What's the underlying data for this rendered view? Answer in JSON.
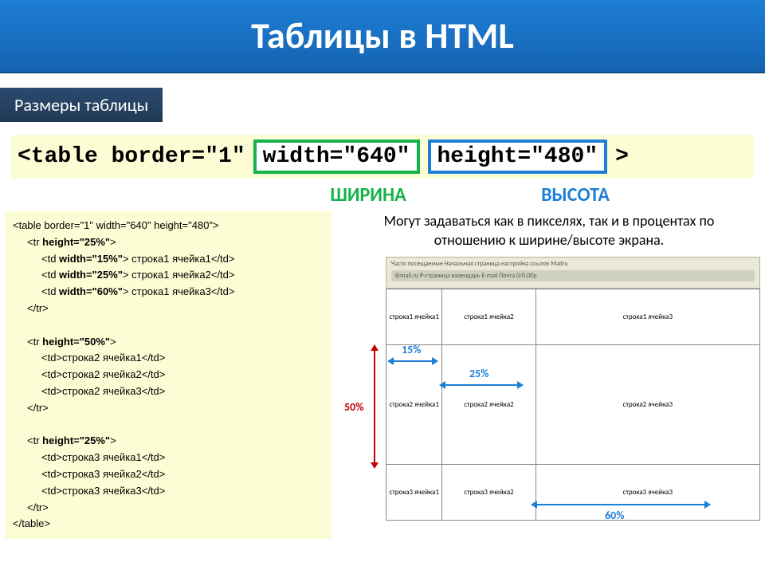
{
  "slide": {
    "title": "Таблицы в HTML",
    "subtitle": "Размеры таблицы"
  },
  "tag_line": {
    "prefix": "<table border=\"1\"",
    "attr_width": "width=\"640\"",
    "attr_height": "height=\"480\"",
    "suffix": ">"
  },
  "labels": {
    "width": "ШИРИНА",
    "height": "ВЫСОТА"
  },
  "description": "Могут задаваться как в пикселях, так и в процентах по отношению к ширине/высоте экрана.",
  "code": [
    {
      "text": "<table border=\"1\" width=\"640\" height=\"480\">",
      "indent": 0,
      "bold": false
    },
    {
      "text": "<tr height=\"25%\">",
      "indent": 1,
      "bold": true
    },
    {
      "text": "<td width=\"15%\"> строка1 ячейка1</td>",
      "indent": 2,
      "bold": true
    },
    {
      "text": "<td width=\"25%\"> строка1 ячейка2</td>",
      "indent": 2,
      "bold": true
    },
    {
      "text": "<td width=\"60%\"> строка1 ячейка3</td>",
      "indent": 2,
      "bold": true
    },
    {
      "text": "</tr>",
      "indent": 1,
      "bold": false
    },
    {
      "text": "",
      "indent": 0,
      "bold": false
    },
    {
      "text": "<tr height=\"50%\">",
      "indent": 1,
      "bold": true
    },
    {
      "text": "<td>строка2 ячейка1</td>",
      "indent": 2,
      "bold": false
    },
    {
      "text": "<td>строка2 ячейка2</td>",
      "indent": 2,
      "bold": false
    },
    {
      "text": "<td>строка2 ячейка3</td>",
      "indent": 2,
      "bold": false
    },
    {
      "text": "</tr>",
      "indent": 1,
      "bold": false
    },
    {
      "text": "",
      "indent": 0,
      "bold": false
    },
    {
      "text": "<tr height=\"25%\">",
      "indent": 1,
      "bold": true
    },
    {
      "text": "<td>строка3 ячейка1</td>",
      "indent": 2,
      "bold": false
    },
    {
      "text": "<td>строка3 ячейка2</td>",
      "indent": 2,
      "bold": false
    },
    {
      "text": "<td>строка3 ячейка3</td>",
      "indent": 2,
      "bold": false
    },
    {
      "text": "</tr>",
      "indent": 1,
      "bold": false
    },
    {
      "text": "</table>",
      "indent": 0,
      "bold": false
    }
  ],
  "preview": {
    "browserbar_line1": "Часто посещаемые   Начальная страница   настройка ссылок   Mailru",
    "browserbar_line2": "@mail.ru   Р-страница календарь   E-mail   Почта   0/0.00р",
    "cells": {
      "r1c1": "строка1 ячейка1",
      "r1c2": "строка1 ячейка2",
      "r1c3": "строка1 ячейка3",
      "r2c1": "строка2 ячейка1",
      "r2c2": "строка2 ячейка2",
      "r2c3": "строка2 ячейка3",
      "r3c1": "строка3 ячейка1",
      "r3c2": "строка3 ячейка2",
      "r3c3": "строка3 ячейка3"
    },
    "pct_15": "15%",
    "pct_25": "25%",
    "pct_50": "50%",
    "pct_60": "60%"
  }
}
